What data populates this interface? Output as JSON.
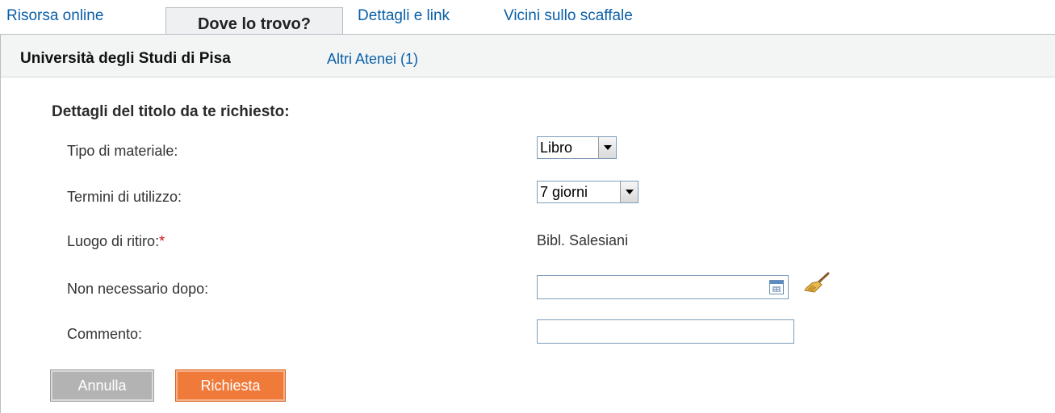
{
  "tabs": [
    {
      "label": "Risorsa online",
      "active": false
    },
    {
      "label": "Dove lo trovo?",
      "active": true
    },
    {
      "label": "Dettagli e link",
      "active": false
    },
    {
      "label": "Vicini sullo scaffale",
      "active": false
    }
  ],
  "institution": {
    "current": "Università degli Studi di Pisa",
    "other_link": "Altri Atenei (1)"
  },
  "form": {
    "title": "Dettagli del titolo da te richiesto:",
    "material_type": {
      "label": "Tipo di materiale:",
      "value": "Libro"
    },
    "usage_terms": {
      "label": "Termini di utilizzo:",
      "value": "7 giorni"
    },
    "pickup": {
      "label": "Luogo di ritiro:",
      "required_mark": "*",
      "value": "Bibl. Salesiani"
    },
    "not_needed_after": {
      "label": "Non necessario dopo:",
      "value": "",
      "calendar_icon": "calendar-icon",
      "clear_icon": "broom-icon"
    },
    "comment": {
      "label": "Commento:",
      "value": ""
    }
  },
  "buttons": {
    "cancel": "Annulla",
    "request": "Richiesta"
  },
  "colors": {
    "link": "#0a5fa8",
    "required": "#cc1111",
    "request_button": "#f07a3a",
    "cancel_button": "#b3b3b3"
  }
}
